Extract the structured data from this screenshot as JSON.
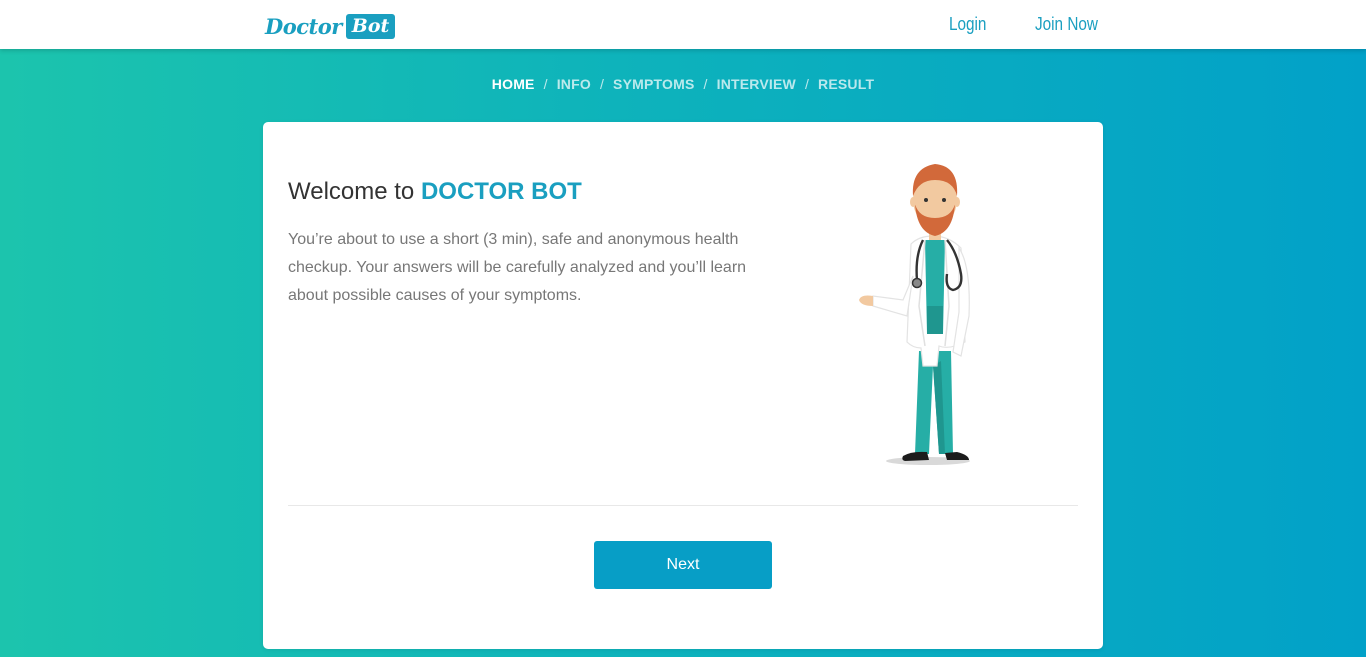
{
  "header": {
    "logo_word": "Doctor",
    "logo_box": "Bot",
    "login_label": "Login",
    "join_label": "Join Now"
  },
  "breadcrumb": {
    "items": [
      "HOME",
      "INFO",
      "SYMPTOMS",
      "INTERVIEW",
      "RESULT"
    ],
    "separator": "/",
    "active": "HOME"
  },
  "card": {
    "welcome_prefix": "Welcome to",
    "welcome_brand": "DOCTOR BOT",
    "intro": "You’re about to use a short (3 min), safe and anonymous health checkup. Your answers will be carefully analyzed and you’ll learn about possible causes of your symptoms.",
    "next_label": "Next",
    "illustration": "doctor-illustration"
  },
  "colors": {
    "accent": "#1a9fc0",
    "button": "#079ec6",
    "gradient_start": "#1cc4ad",
    "gradient_end": "#02a1c8"
  }
}
